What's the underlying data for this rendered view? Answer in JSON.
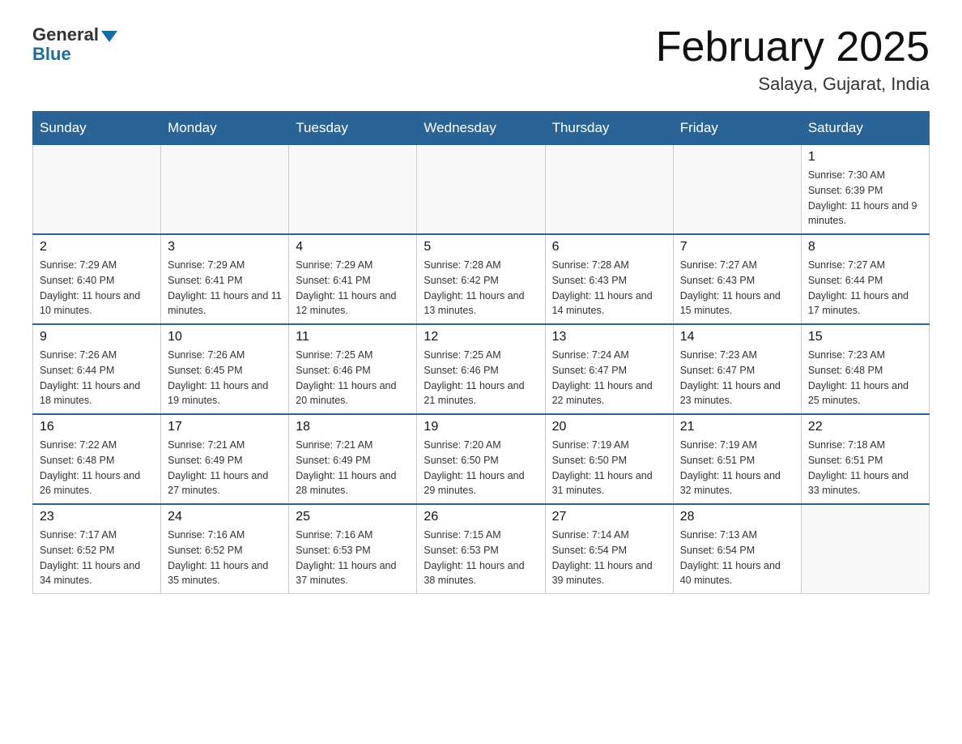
{
  "logo": {
    "general": "General",
    "blue": "Blue"
  },
  "title": "February 2025",
  "location": "Salaya, Gujarat, India",
  "weekdays": [
    "Sunday",
    "Monday",
    "Tuesday",
    "Wednesday",
    "Thursday",
    "Friday",
    "Saturday"
  ],
  "weeks": [
    [
      {
        "day": "",
        "info": ""
      },
      {
        "day": "",
        "info": ""
      },
      {
        "day": "",
        "info": ""
      },
      {
        "day": "",
        "info": ""
      },
      {
        "day": "",
        "info": ""
      },
      {
        "day": "",
        "info": ""
      },
      {
        "day": "1",
        "info": "Sunrise: 7:30 AM\nSunset: 6:39 PM\nDaylight: 11 hours and 9 minutes."
      }
    ],
    [
      {
        "day": "2",
        "info": "Sunrise: 7:29 AM\nSunset: 6:40 PM\nDaylight: 11 hours and 10 minutes."
      },
      {
        "day": "3",
        "info": "Sunrise: 7:29 AM\nSunset: 6:41 PM\nDaylight: 11 hours and 11 minutes."
      },
      {
        "day": "4",
        "info": "Sunrise: 7:29 AM\nSunset: 6:41 PM\nDaylight: 11 hours and 12 minutes."
      },
      {
        "day": "5",
        "info": "Sunrise: 7:28 AM\nSunset: 6:42 PM\nDaylight: 11 hours and 13 minutes."
      },
      {
        "day": "6",
        "info": "Sunrise: 7:28 AM\nSunset: 6:43 PM\nDaylight: 11 hours and 14 minutes."
      },
      {
        "day": "7",
        "info": "Sunrise: 7:27 AM\nSunset: 6:43 PM\nDaylight: 11 hours and 15 minutes."
      },
      {
        "day": "8",
        "info": "Sunrise: 7:27 AM\nSunset: 6:44 PM\nDaylight: 11 hours and 17 minutes."
      }
    ],
    [
      {
        "day": "9",
        "info": "Sunrise: 7:26 AM\nSunset: 6:44 PM\nDaylight: 11 hours and 18 minutes."
      },
      {
        "day": "10",
        "info": "Sunrise: 7:26 AM\nSunset: 6:45 PM\nDaylight: 11 hours and 19 minutes."
      },
      {
        "day": "11",
        "info": "Sunrise: 7:25 AM\nSunset: 6:46 PM\nDaylight: 11 hours and 20 minutes."
      },
      {
        "day": "12",
        "info": "Sunrise: 7:25 AM\nSunset: 6:46 PM\nDaylight: 11 hours and 21 minutes."
      },
      {
        "day": "13",
        "info": "Sunrise: 7:24 AM\nSunset: 6:47 PM\nDaylight: 11 hours and 22 minutes."
      },
      {
        "day": "14",
        "info": "Sunrise: 7:23 AM\nSunset: 6:47 PM\nDaylight: 11 hours and 23 minutes."
      },
      {
        "day": "15",
        "info": "Sunrise: 7:23 AM\nSunset: 6:48 PM\nDaylight: 11 hours and 25 minutes."
      }
    ],
    [
      {
        "day": "16",
        "info": "Sunrise: 7:22 AM\nSunset: 6:48 PM\nDaylight: 11 hours and 26 minutes."
      },
      {
        "day": "17",
        "info": "Sunrise: 7:21 AM\nSunset: 6:49 PM\nDaylight: 11 hours and 27 minutes."
      },
      {
        "day": "18",
        "info": "Sunrise: 7:21 AM\nSunset: 6:49 PM\nDaylight: 11 hours and 28 minutes."
      },
      {
        "day": "19",
        "info": "Sunrise: 7:20 AM\nSunset: 6:50 PM\nDaylight: 11 hours and 29 minutes."
      },
      {
        "day": "20",
        "info": "Sunrise: 7:19 AM\nSunset: 6:50 PM\nDaylight: 11 hours and 31 minutes."
      },
      {
        "day": "21",
        "info": "Sunrise: 7:19 AM\nSunset: 6:51 PM\nDaylight: 11 hours and 32 minutes."
      },
      {
        "day": "22",
        "info": "Sunrise: 7:18 AM\nSunset: 6:51 PM\nDaylight: 11 hours and 33 minutes."
      }
    ],
    [
      {
        "day": "23",
        "info": "Sunrise: 7:17 AM\nSunset: 6:52 PM\nDaylight: 11 hours and 34 minutes."
      },
      {
        "day": "24",
        "info": "Sunrise: 7:16 AM\nSunset: 6:52 PM\nDaylight: 11 hours and 35 minutes."
      },
      {
        "day": "25",
        "info": "Sunrise: 7:16 AM\nSunset: 6:53 PM\nDaylight: 11 hours and 37 minutes."
      },
      {
        "day": "26",
        "info": "Sunrise: 7:15 AM\nSunset: 6:53 PM\nDaylight: 11 hours and 38 minutes."
      },
      {
        "day": "27",
        "info": "Sunrise: 7:14 AM\nSunset: 6:54 PM\nDaylight: 11 hours and 39 minutes."
      },
      {
        "day": "28",
        "info": "Sunrise: 7:13 AM\nSunset: 6:54 PM\nDaylight: 11 hours and 40 minutes."
      },
      {
        "day": "",
        "info": ""
      }
    ]
  ]
}
